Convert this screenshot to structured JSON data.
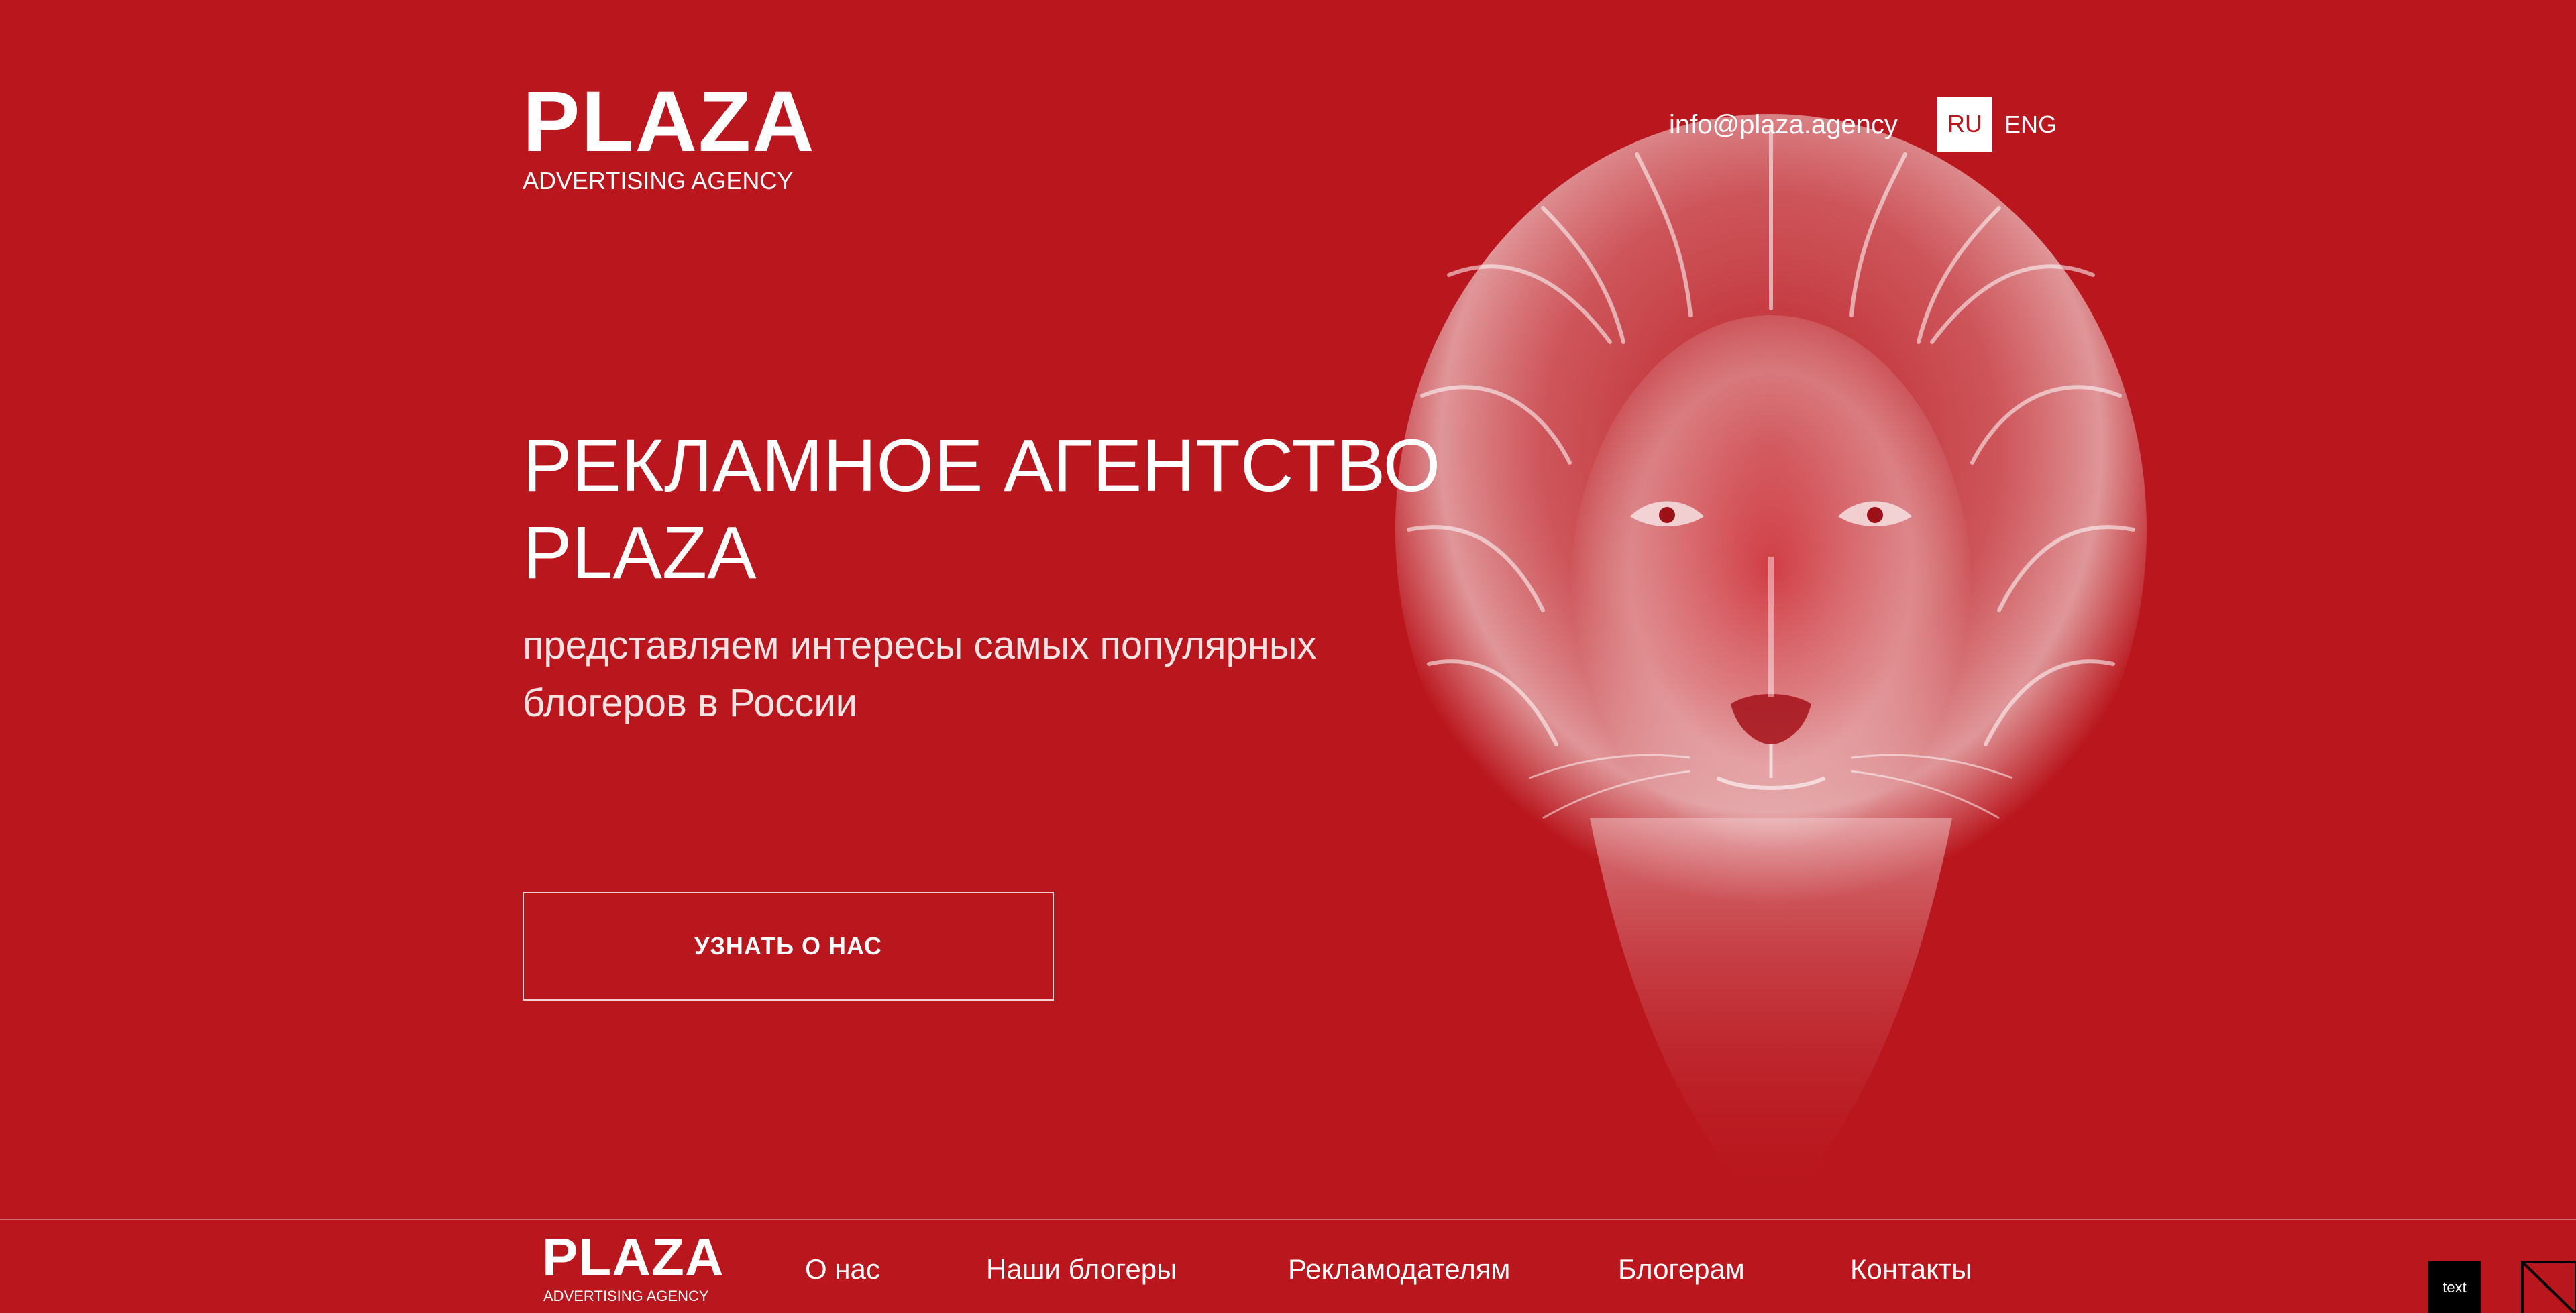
{
  "brand": {
    "name": "PLAZA",
    "tagline": "ADVERTISING AGENCY"
  },
  "header": {
    "email": "info@plaza.agency",
    "languages": [
      {
        "label": "RU",
        "active": true
      },
      {
        "label": "ENG",
        "active": false
      }
    ]
  },
  "hero": {
    "title_lines": [
      "РЕКЛАМНОЕ АГЕНТСТВО",
      "PLAZA"
    ],
    "subtitle_lines": [
      "представляем интересы самых популярных",
      "блогеров в России"
    ],
    "cta_label": "УЗНАТЬ О НАС"
  },
  "nav": {
    "items": [
      {
        "label": "О нас"
      },
      {
        "label": "Наши блогеры"
      },
      {
        "label": "Рекламодателям"
      },
      {
        "label": "Блогерам"
      },
      {
        "label": "Контакты"
      }
    ]
  },
  "widget": {
    "badge_label": "text"
  },
  "colors": {
    "background": "#b9161d",
    "text": "#ffffff"
  },
  "icons": {
    "hero_image": "lion-illustration",
    "corner": "corner-toggle-icon"
  }
}
